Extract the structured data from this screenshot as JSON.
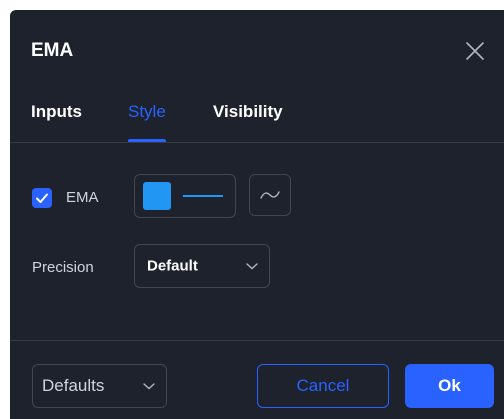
{
  "dialog": {
    "title": "EMA"
  },
  "tabs": [
    {
      "label": "Inputs",
      "active": false
    },
    {
      "label": "Style",
      "active": true
    },
    {
      "label": "Visibility",
      "active": false
    }
  ],
  "style": {
    "ema_row": {
      "checkbox_checked": true,
      "label": "EMA",
      "color": "#2196f3",
      "line_icon": "line-style-icon",
      "plot_type_icon": "wave-line-icon"
    },
    "precision_row": {
      "label": "Precision",
      "value": "Default"
    }
  },
  "footer": {
    "defaults_label": "Defaults",
    "cancel_label": "Cancel",
    "ok_label": "Ok"
  },
  "colors": {
    "background": "#1e222d",
    "accent": "#2962ff",
    "border": "#434651",
    "divider": "#363a45",
    "text": "#d1d4dc"
  },
  "icons": {
    "close": "close-icon",
    "checkmark": "checkmark-icon",
    "chevron": "chevron-down-icon"
  }
}
